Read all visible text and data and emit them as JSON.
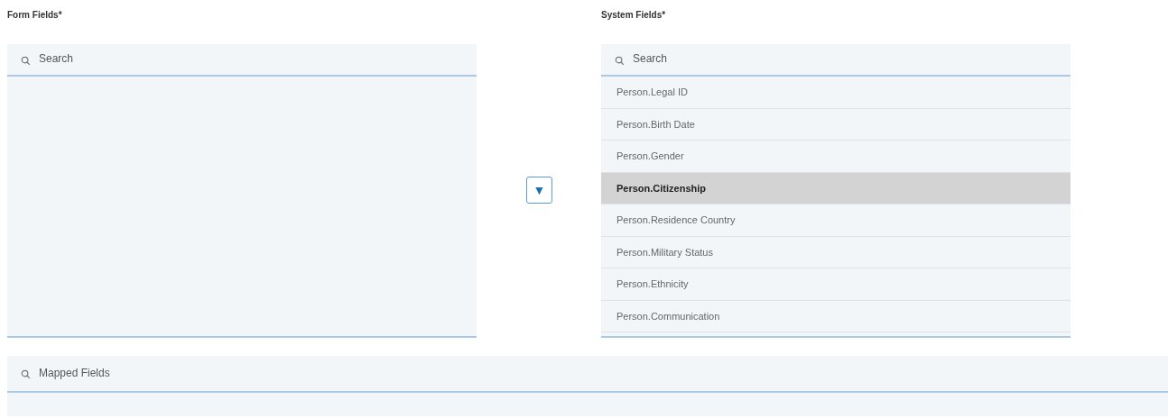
{
  "form_fields": {
    "label": "Form Fields*",
    "search": {
      "placeholder": "Search"
    }
  },
  "move_button": {
    "icon": "▼"
  },
  "system_fields": {
    "label": "System Fields*",
    "search": {
      "placeholder": "Search"
    },
    "items": [
      {
        "label": "Person.Legal ID",
        "selected": false
      },
      {
        "label": "Person.Birth Date",
        "selected": false
      },
      {
        "label": "Person.Gender",
        "selected": false
      },
      {
        "label": "Person.Citizenship",
        "selected": true
      },
      {
        "label": "Person.Residence Country",
        "selected": false
      },
      {
        "label": "Person.Military Status",
        "selected": false
      },
      {
        "label": "Person.Ethnicity",
        "selected": false
      },
      {
        "label": "Person.Communication",
        "selected": false
      }
    ]
  },
  "mapped_fields": {
    "search": {
      "placeholder": "Mapped Fields"
    }
  }
}
